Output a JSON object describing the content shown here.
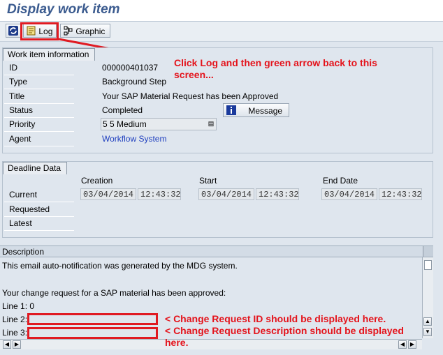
{
  "page": {
    "title": "Display work item"
  },
  "toolbar": {
    "refresh_icon": "refresh-icon",
    "log_label": "Log",
    "graphic_label": "Graphic"
  },
  "work_item": {
    "section_title": "Work item information",
    "fields": [
      {
        "label": "ID",
        "value": "000000401037"
      },
      {
        "label": "Type",
        "value": "Background Step"
      },
      {
        "label": "Title",
        "value": "Your SAP Material Request has been Approved"
      },
      {
        "label": "Status",
        "value": "Completed"
      },
      {
        "label": "Priority",
        "value": "5 5 Medium"
      },
      {
        "label": "Agent",
        "value": "Workflow System"
      }
    ],
    "message_button": "Message"
  },
  "deadline": {
    "section_title": "Deadline Data",
    "columns": [
      "Creation",
      "Start",
      "End Date"
    ],
    "rows": [
      {
        "label": "Current",
        "creation_date": "03/04/2014",
        "creation_time": "12:43:32",
        "start_date": "03/04/2014",
        "start_time": "12:43:32",
        "end_date": "03/04/2014",
        "end_time": "12:43:32"
      },
      {
        "label": "Requested"
      },
      {
        "label": "Latest"
      }
    ]
  },
  "description": {
    "header": "Description",
    "lines": [
      "This email auto-notification was generated by the MDG system.",
      "",
      "Your change request for a SAP material has been approved:",
      "Line 1: 0",
      "Line 2:",
      "Line 3:"
    ]
  },
  "annotations": {
    "log_hint": "Click Log and then green arrow back to this screen...",
    "line2_hint": "< Change Request ID should be displayed here.",
    "line3_hint": "< Change Request Description should be displayed here."
  },
  "colors": {
    "accent": "#3b5b8f",
    "annotation": "#e4131b",
    "link": "#1f3fbf"
  }
}
